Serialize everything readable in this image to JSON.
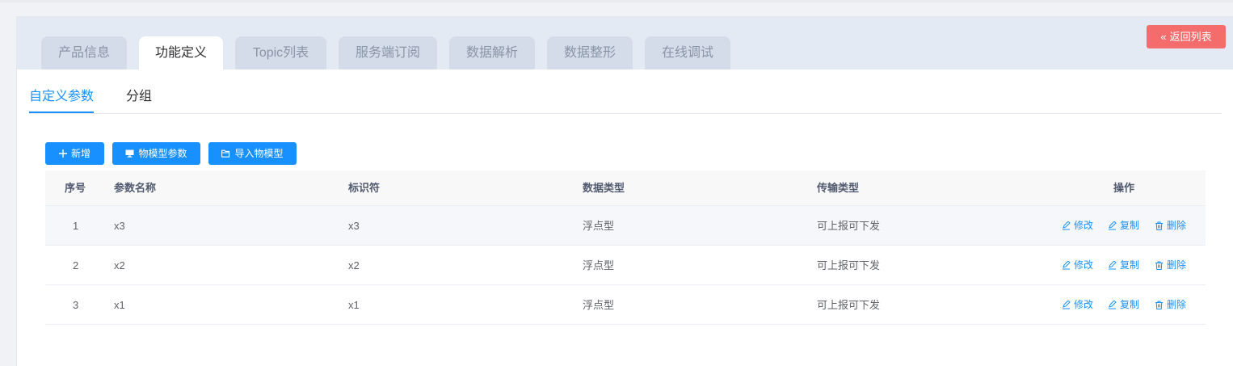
{
  "tabs": [
    {
      "label": "产品信息",
      "active": false
    },
    {
      "label": "功能定义",
      "active": true
    },
    {
      "label": "Topic列表",
      "active": false
    },
    {
      "label": "服务端订阅",
      "active": false
    },
    {
      "label": "数据解析",
      "active": false
    },
    {
      "label": "数据整形",
      "active": false
    },
    {
      "label": "在线调试",
      "active": false
    }
  ],
  "back_button": {
    "label": "返回列表",
    "icon": "double-chevron-left-icon",
    "color": "#f56c6c"
  },
  "subtabs": [
    {
      "label": "自定义参数",
      "active": true
    },
    {
      "label": "分组",
      "active": false
    }
  ],
  "toolbar": {
    "add_label": "新增",
    "model_params_label": "物模型参数",
    "import_model_label": "导入物模型",
    "accent": "#1890ff"
  },
  "table": {
    "headers": {
      "index": "序号",
      "name": "参数名称",
      "identifier": "标识符",
      "data_type": "数据类型",
      "transfer_type": "传输类型",
      "actions": "操作"
    },
    "rows": [
      {
        "index": "1",
        "name": "x3",
        "identifier": "x3",
        "data_type": "浮点型",
        "transfer_type": "可上报可下发"
      },
      {
        "index": "2",
        "name": "x2",
        "identifier": "x2",
        "data_type": "浮点型",
        "transfer_type": "可上报可下发"
      },
      {
        "index": "3",
        "name": "x1",
        "identifier": "x1",
        "data_type": "浮点型",
        "transfer_type": "可上报可下发"
      }
    ],
    "actions": {
      "edit": "修改",
      "copy": "复制",
      "delete": "删除"
    }
  }
}
